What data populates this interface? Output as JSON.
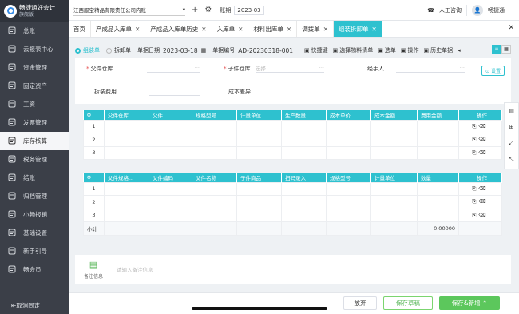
{
  "brand": {
    "name": "畅捷通好会计",
    "edition": "旗舰版"
  },
  "nav": [
    {
      "label": "总账",
      "icon": "ledger-icon"
    },
    {
      "label": "云报表中心",
      "icon": "report-icon"
    },
    {
      "label": "资金管理",
      "icon": "funds-icon"
    },
    {
      "label": "固定资产",
      "icon": "asset-icon"
    },
    {
      "label": "工资",
      "icon": "salary-icon"
    },
    {
      "label": "发票管理",
      "icon": "invoice-icon"
    },
    {
      "label": "库存核算",
      "icon": "warehouse-icon",
      "active": true
    },
    {
      "label": "税务管理",
      "icon": "tax-icon"
    },
    {
      "label": "结账",
      "icon": "close-books-icon"
    },
    {
      "label": "归档管理",
      "icon": "archive-icon"
    },
    {
      "label": "小畅报销",
      "icon": "reimburse-icon"
    },
    {
      "label": "基础设置",
      "icon": "settings-icon"
    },
    {
      "label": "新手引导",
      "icon": "guide-icon"
    },
    {
      "label": "畅会员",
      "icon": "member-icon"
    }
  ],
  "collapse_label": "取消固定",
  "topbar": {
    "company": "江西服宝精品有限责任公司内账",
    "period_label": "账期",
    "period_value": "2023-03",
    "support": "人工咨询",
    "user": "畅捷通"
  },
  "tabs": [
    {
      "label": "首页",
      "closable": false
    },
    {
      "label": "产成品入库单",
      "closable": true
    },
    {
      "label": "产成品入库单历史",
      "closable": true
    },
    {
      "label": "入库单",
      "closable": true
    },
    {
      "label": "材料出库单",
      "closable": true
    },
    {
      "label": "调拨单",
      "closable": true
    },
    {
      "label": "组装拆卸单",
      "closable": true,
      "active": true
    }
  ],
  "toolbar": {
    "radio_assemble": "组装单",
    "radio_disassemble": "拆卸单",
    "date_label": "单据日期",
    "date_value": "2023-03-18",
    "no_label": "单据编号",
    "no_value": "AD-20230318-001",
    "actions": [
      "快捷键",
      "选择物料清单",
      "选单",
      "操作",
      "历史单据"
    ]
  },
  "form": {
    "parent_wh": "父件仓库",
    "child_wh": "子件仓库",
    "child_placeholder": "选择...",
    "handler": "经手人",
    "disassemble_fee": "拆装费用",
    "cost_diff": "成本差异",
    "settings": "设置"
  },
  "table1": {
    "headers": [
      "父件仓库",
      "父件...",
      "规格型号",
      "计量单位",
      "生产数量",
      "成本单价",
      "成本金额",
      "费用金额",
      "操作"
    ],
    "rows": [
      "1",
      "2",
      "3"
    ]
  },
  "table2": {
    "headers": [
      "父件规格...",
      "父件编码",
      "父件名称",
      "子件商品",
      "扫码录入",
      "规格型号",
      "计量单位",
      "数量",
      "操作"
    ],
    "rows": [
      "1",
      "2",
      "3"
    ],
    "subtotal_label": "小计",
    "subtotal_qty": "0.00000"
  },
  "remark": {
    "label": "备注信息",
    "placeholder": "请输入备注信息"
  },
  "footer": {
    "discard": "放弃",
    "save_draft": "保存草稿",
    "save_new": "保存&新增"
  }
}
